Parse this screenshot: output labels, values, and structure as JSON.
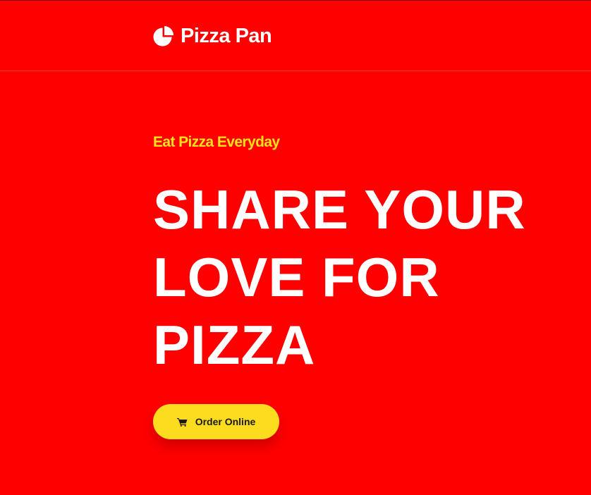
{
  "header": {
    "brand_name": "Pizza Pan",
    "logo_icon": "pizza-pie-icon"
  },
  "hero": {
    "tagline": "Eat Pizza Everyday",
    "headline_lines": [
      "SHARE YOUR",
      "LOVE FOR",
      "PIZZA"
    ],
    "cta": {
      "label": "Order Online",
      "icon": "cart-icon"
    }
  },
  "colors": {
    "background": "#ff0000",
    "accent_yellow": "#fbdc1e",
    "tagline_yellow": "#ffe11b",
    "text_white": "#ffffff"
  }
}
